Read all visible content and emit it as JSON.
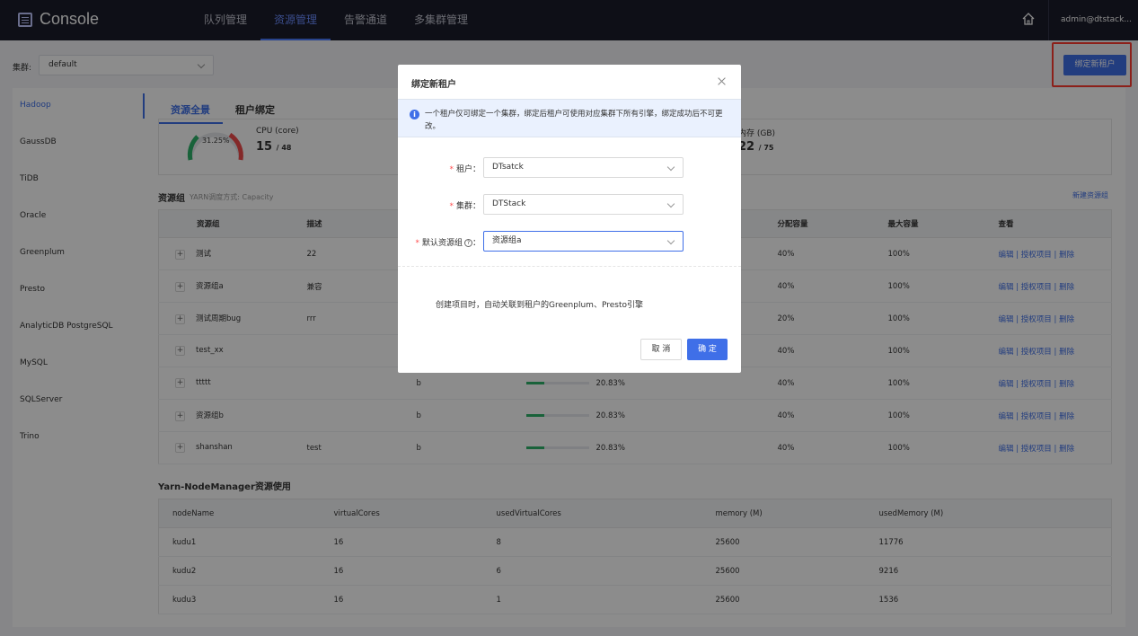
{
  "app": {
    "title": "Console",
    "user": "admin@dtstack..."
  },
  "nav": [
    {
      "label": "队列管理"
    },
    {
      "label": "资源管理",
      "active": true
    },
    {
      "label": "告警通道"
    },
    {
      "label": "多集群管理"
    }
  ],
  "cluster": {
    "label": "集群:",
    "value": "default"
  },
  "bind_button": "绑定新租户",
  "sidebar": [
    "Hadoop",
    "GaussDB",
    "TiDB",
    "Oracle",
    "Greenplum",
    "Presto",
    "AnalyticDB PostgreSQL",
    "MySQL",
    "SQLServer",
    "Trino"
  ],
  "tabs": [
    "资源全景",
    "租户绑定"
  ],
  "usage": {
    "percent": "31.25%",
    "percent_value": 31.25,
    "cpu_label": "CPU (core)",
    "cpu_used": "15",
    "cpu_total": "/ 48",
    "mem_label": "内存 (GB)",
    "mem_used": "22",
    "mem_total": "/ 75"
  },
  "resource_groups": {
    "title": "资源组",
    "subtitle": "YARN调度方式: Capacity",
    "new_label": "新建资源组",
    "headers": [
      "资源组",
      "描述",
      "分配容量",
      "最大容量",
      "查看"
    ],
    "rows": [
      {
        "name": "测试",
        "desc": "22",
        "cap": "40%",
        "max": "100%"
      },
      {
        "name": "资源组a",
        "desc": "兼容",
        "cap": "40%",
        "max": "100%"
      },
      {
        "name": "测试周期bug",
        "desc": "rrr",
        "cap": "20%",
        "max": "100%"
      },
      {
        "name": "test_xx",
        "desc": "",
        "cap": "40%",
        "max": "100%"
      },
      {
        "name": "ttttt",
        "desc": "",
        "extra": "b",
        "usage": "20.83%",
        "usage_value": 20.83,
        "cap": "40%",
        "max": "100%"
      },
      {
        "name": "资源组b",
        "desc": "",
        "extra": "b",
        "usage": "20.83%",
        "usage_value": 20.83,
        "cap": "40%",
        "max": "100%"
      },
      {
        "name": "shanshan",
        "desc": "test",
        "extra": "b",
        "usage": "20.83%",
        "usage_value": 20.83,
        "cap": "40%",
        "max": "100%"
      }
    ],
    "actions": {
      "edit": "编辑",
      "auth": "授权项目",
      "delete": "删除",
      "sep": "|"
    }
  },
  "node_manager": {
    "title": "Yarn-NodeManager资源使用",
    "headers": [
      "nodeName",
      "virtualCores",
      "usedVirtualCores",
      "memory (M)",
      "usedMemory (M)"
    ],
    "rows": [
      [
        "kudu1",
        "16",
        "8",
        "25600",
        "11776"
      ],
      [
        "kudu2",
        "16",
        "6",
        "25600",
        "9216"
      ],
      [
        "kudu3",
        "16",
        "1",
        "25600",
        "1536"
      ]
    ]
  },
  "modal": {
    "title": "绑定新租户",
    "info": "一个租户仅可绑定一个集群，绑定后租户可使用对应集群下所有引擎，绑定成功后不可更改。",
    "tenant_label": "租户",
    "tenant_value": "DTsatck",
    "cluster_label": "集群",
    "cluster_value": "DTStack",
    "group_label": "默认资源组",
    "group_value": "资源组a",
    "note": "创建项目时，自动关联到租户的Greenplum、Presto引擎",
    "cancel": "取 消",
    "ok": "确 定"
  },
  "colors": {
    "accent": "#3f6fe8",
    "topbar": "#1b1c2a",
    "highlight": "#ff3b30",
    "progress": "#2eb26a"
  }
}
